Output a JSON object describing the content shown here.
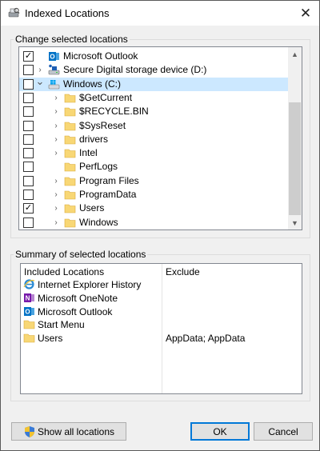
{
  "window": {
    "title": "Indexed Locations",
    "close_glyph": "✕"
  },
  "change_group": {
    "label": "Change selected locations"
  },
  "tree": [
    {
      "label": "Microsoft Outlook",
      "checked": true,
      "expander": "",
      "icon": "outlook-icon",
      "indent": 0
    },
    {
      "label": "Secure Digital storage device (D:)",
      "checked": false,
      "expander": "›",
      "icon": "drive-icon",
      "indent": 0
    },
    {
      "label": "Windows (C:)",
      "checked": false,
      "expander": "⌄",
      "icon": "windows-drive-icon",
      "indent": 0,
      "selected": true
    },
    {
      "label": "$GetCurrent",
      "checked": false,
      "expander": "›",
      "icon": "folder-icon",
      "indent": 1
    },
    {
      "label": "$RECYCLE.BIN",
      "checked": false,
      "expander": "›",
      "icon": "folder-icon",
      "indent": 1
    },
    {
      "label": "$SysReset",
      "checked": false,
      "expander": "›",
      "icon": "folder-icon",
      "indent": 1
    },
    {
      "label": "drivers",
      "checked": false,
      "expander": "›",
      "icon": "folder-icon",
      "indent": 1
    },
    {
      "label": "Intel",
      "checked": false,
      "expander": "›",
      "icon": "folder-icon",
      "indent": 1
    },
    {
      "label": "PerfLogs",
      "checked": false,
      "expander": "",
      "icon": "folder-icon",
      "indent": 1
    },
    {
      "label": "Program Files",
      "checked": false,
      "expander": "›",
      "icon": "folder-icon",
      "indent": 1
    },
    {
      "label": "ProgramData",
      "checked": false,
      "expander": "›",
      "icon": "folder-icon",
      "indent": 1
    },
    {
      "label": "Users",
      "checked": true,
      "expander": "›",
      "icon": "folder-icon",
      "indent": 1
    },
    {
      "label": "Windows",
      "checked": false,
      "expander": "›",
      "icon": "folder-icon",
      "indent": 1
    }
  ],
  "summary_group": {
    "label": "Summary of selected locations"
  },
  "summary": {
    "col_included": "Included Locations",
    "col_exclude": "Exclude",
    "rows": [
      {
        "label": "Internet Explorer History",
        "icon": "ie-icon",
        "exclude": ""
      },
      {
        "label": "Microsoft OneNote",
        "icon": "onenote-icon",
        "exclude": ""
      },
      {
        "label": "Microsoft Outlook",
        "icon": "outlook-icon",
        "exclude": ""
      },
      {
        "label": "Start Menu",
        "icon": "folder-icon",
        "exclude": ""
      },
      {
        "label": "Users",
        "icon": "folder-icon",
        "exclude": "AppData; AppData"
      }
    ]
  },
  "buttons": {
    "show_all": "Show all locations",
    "ok": "OK",
    "cancel": "Cancel"
  },
  "colors": {
    "selection": "#cce8ff",
    "folder": "#f8d775",
    "outlook": "#0072c6",
    "onenote": "#7719aa",
    "default_button": "#0078d7"
  }
}
